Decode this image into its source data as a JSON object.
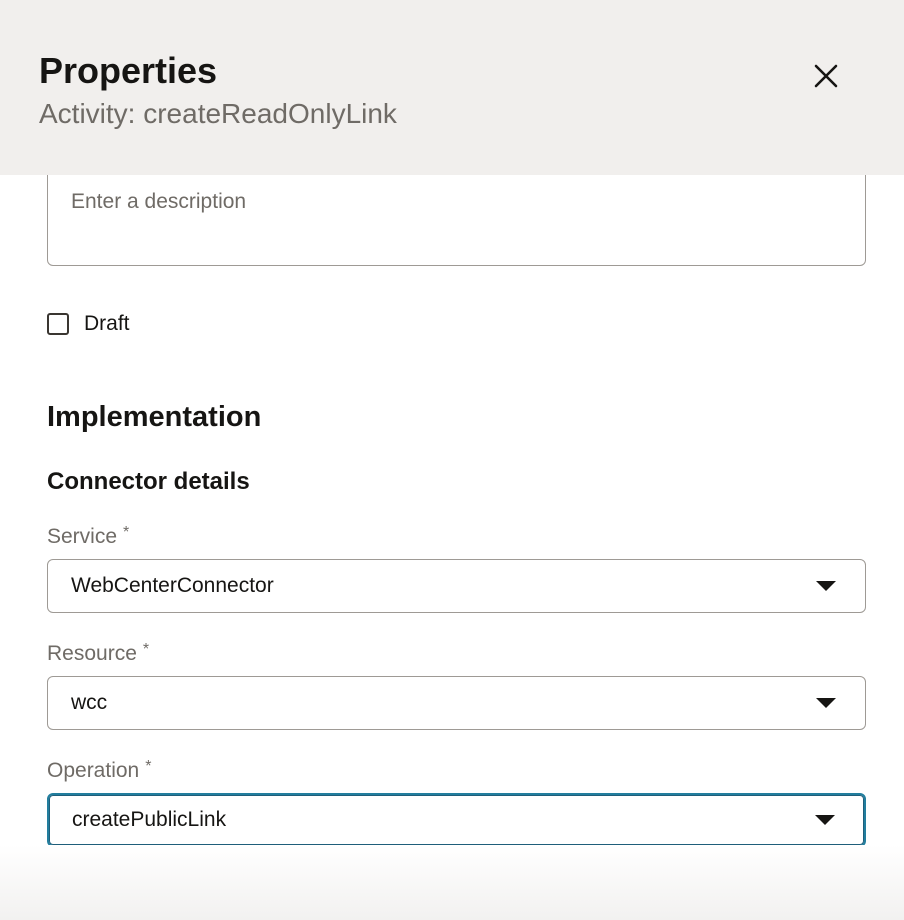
{
  "header": {
    "title": "Properties",
    "subtitle": "Activity: createReadOnlyLink"
  },
  "description": {
    "placeholder": "Enter a description",
    "value": ""
  },
  "draft": {
    "label": "Draft",
    "checked": false
  },
  "implementation": {
    "title": "Implementation",
    "connector_title": "Connector details"
  },
  "fields": {
    "service": {
      "label": "Service",
      "required": "*",
      "value": "WebCenterConnector"
    },
    "resource": {
      "label": "Resource",
      "required": "*",
      "value": "wcc"
    },
    "operation": {
      "label": "Operation",
      "required": "*",
      "value": "createPublicLink"
    }
  },
  "icons": {
    "close": "close-icon",
    "caret": "chevron-down-icon"
  },
  "colors": {
    "header_bg": "#f1efed",
    "focus_border": "#227e9e",
    "text_primary": "#161513",
    "text_secondary": "#6f6b66"
  }
}
